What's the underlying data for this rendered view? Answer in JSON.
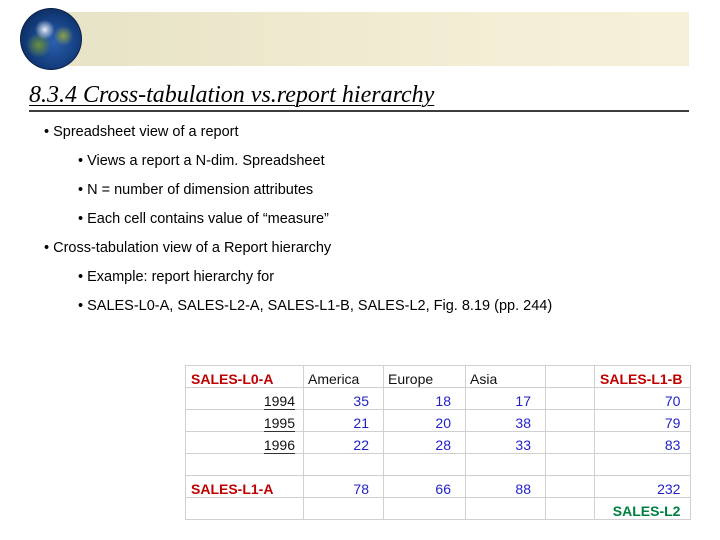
{
  "slide": {
    "title": "8.3.4 Cross-tabulation vs.report hierarchy",
    "bullets": [
      {
        "level": 1,
        "text": "• Spreadsheet view of a report"
      },
      {
        "level": 2,
        "text": "• Views a report a N-dim. Spreadsheet"
      },
      {
        "level": 2,
        "text": "• N = number of dimension attributes"
      },
      {
        "level": 2,
        "text": "• Each cell contains value of “measure”"
      },
      {
        "level": 1,
        "text": "• Cross-tabulation view of a Report hierarchy"
      },
      {
        "level": 2,
        "text": "• Example: report hierarchy for"
      },
      {
        "level": 2,
        "text": "• SALES-L0-A, SALES-L2-A, SALES-L1-B, SALES-L2, Fig. 8.19 (pp. 244)"
      }
    ]
  },
  "table": {
    "corner_label": "SALES-L0-A",
    "columns": [
      "America",
      "Europe",
      "Asia"
    ],
    "right_label": "SALES-L1-B",
    "rows": [
      {
        "year": "1994",
        "values": [
          "35",
          "18",
          "17"
        ],
        "total": "70"
      },
      {
        "year": "1995",
        "values": [
          "21",
          "20",
          "38"
        ],
        "total": "79"
      },
      {
        "year": "1996",
        "values": [
          "22",
          "28",
          "33"
        ],
        "total": "83"
      }
    ],
    "sum_label": "SALES-L1-A",
    "sums": [
      "78",
      "66",
      "88"
    ],
    "grand_total": "232",
    "grand_label": "SALES-L2"
  },
  "colors": {
    "label_red": "#c00000",
    "value_blue": "#1f1fc8",
    "total_green": "#008040",
    "header_band": "#efe9cf"
  },
  "icons": [
    "globe-icon"
  ]
}
